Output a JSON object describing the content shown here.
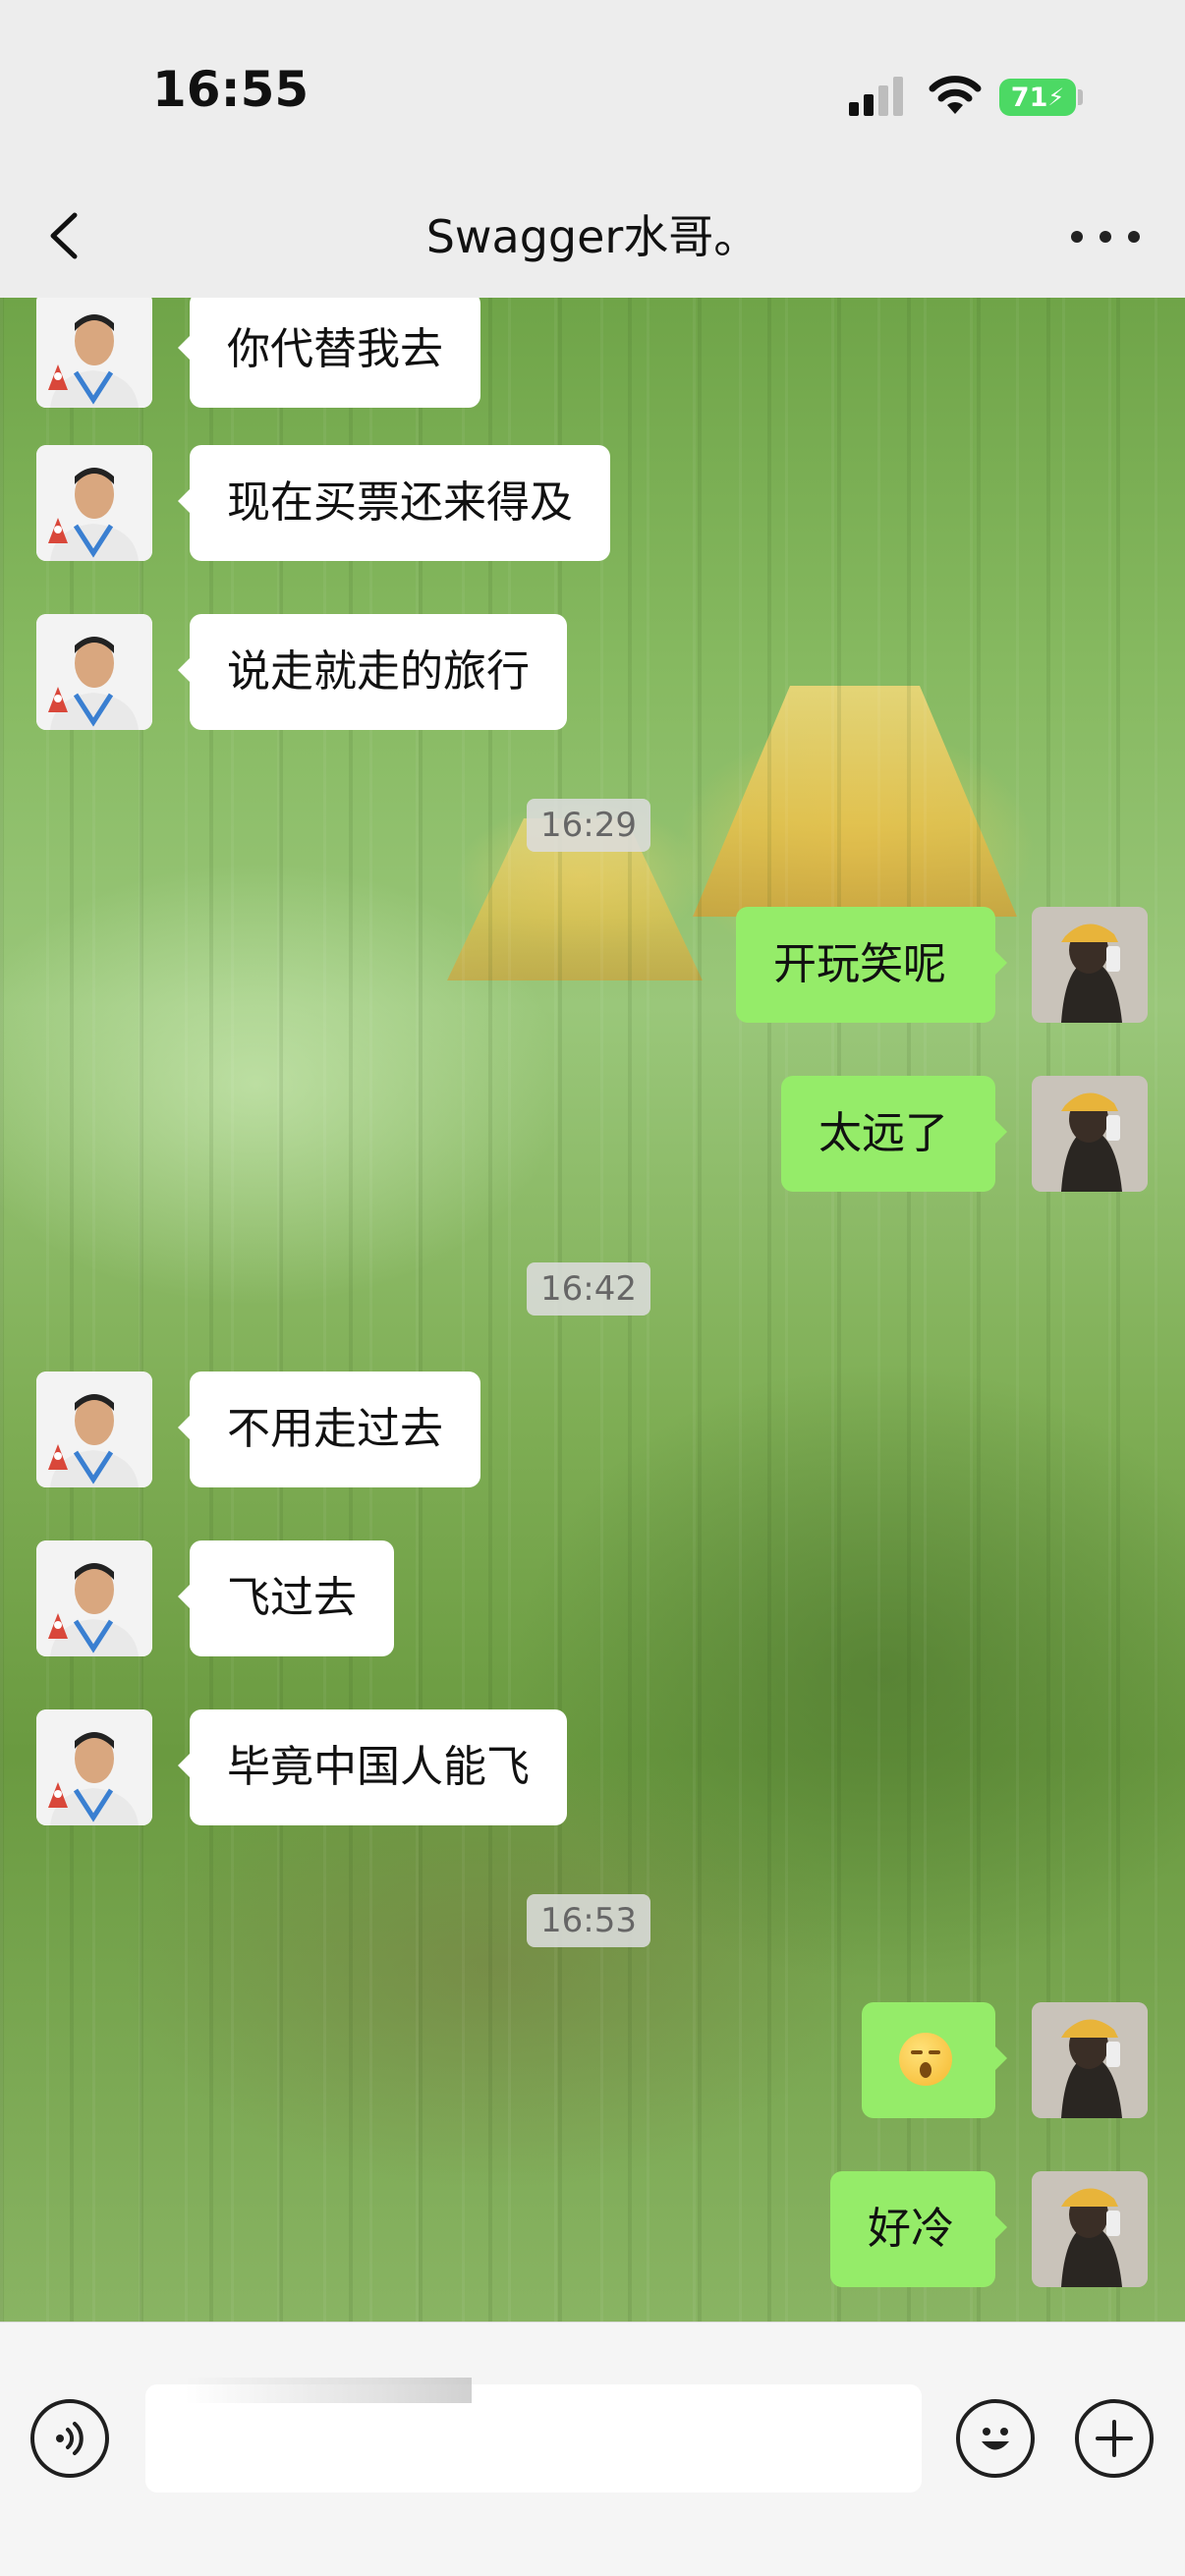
{
  "status_bar": {
    "time": "16:55",
    "battery": "71"
  },
  "header": {
    "title": "Swagger水哥。"
  },
  "messages": [
    {
      "type": "text",
      "from": "other",
      "text": "你代替我去"
    },
    {
      "type": "text",
      "from": "other",
      "text": "现在买票还来得及"
    },
    {
      "type": "text",
      "from": "other",
      "text": "说走就走的旅行"
    },
    {
      "type": "time",
      "text": "16:29"
    },
    {
      "type": "text",
      "from": "me",
      "text": "开玩笑呢"
    },
    {
      "type": "text",
      "from": "me",
      "text": "太远了"
    },
    {
      "type": "time",
      "text": "16:42"
    },
    {
      "type": "text",
      "from": "other",
      "text": "不用走过去"
    },
    {
      "type": "text",
      "from": "other",
      "text": "飞过去"
    },
    {
      "type": "text",
      "from": "other",
      "text": "毕竟中国人能飞"
    },
    {
      "type": "time",
      "text": "16:53"
    },
    {
      "type": "emoji",
      "from": "me",
      "icon": "emoji-shocked-icon"
    },
    {
      "type": "text",
      "from": "me",
      "text": "好冷"
    }
  ],
  "input_bar": {
    "value": "",
    "icons": [
      "voice-icon",
      "emoji-icon",
      "plus-icon"
    ]
  },
  "colors": {
    "my_bubble": "#95ec69",
    "other_bubble": "#ffffff",
    "battery": "#4cd964"
  }
}
